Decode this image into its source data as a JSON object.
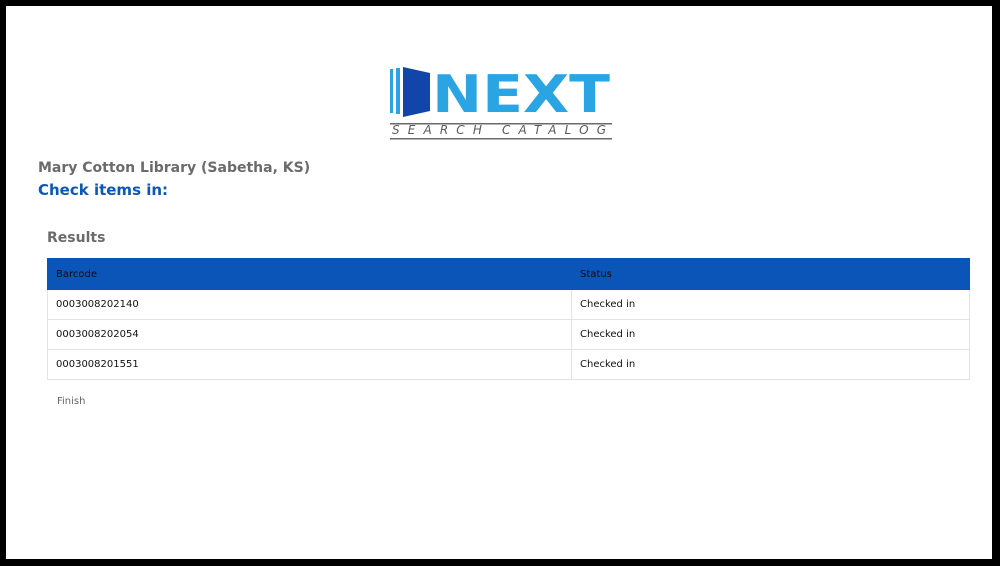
{
  "logo": {
    "word": "NEXT",
    "tagline": "SEARCH CATALOG"
  },
  "library_name": "Mary Cotton Library (Sabetha, KS)",
  "page_heading": "Check items in:",
  "results": {
    "heading": "Results",
    "columns": [
      "Barcode",
      "Status"
    ],
    "rows": [
      {
        "barcode": "0003008202140",
        "status": "Checked in"
      },
      {
        "barcode": "0003008202054",
        "status": "Checked in"
      },
      {
        "barcode": "0003008201551",
        "status": "Checked in"
      }
    ]
  },
  "finish_label": "Finish",
  "colors": {
    "brand_blue": "#0b55b8",
    "logo_light_blue": "#2aa4e3",
    "logo_dark_blue": "#1146a8",
    "heading_blue": "#0a58b8",
    "gray_text": "#6b6b6b"
  }
}
